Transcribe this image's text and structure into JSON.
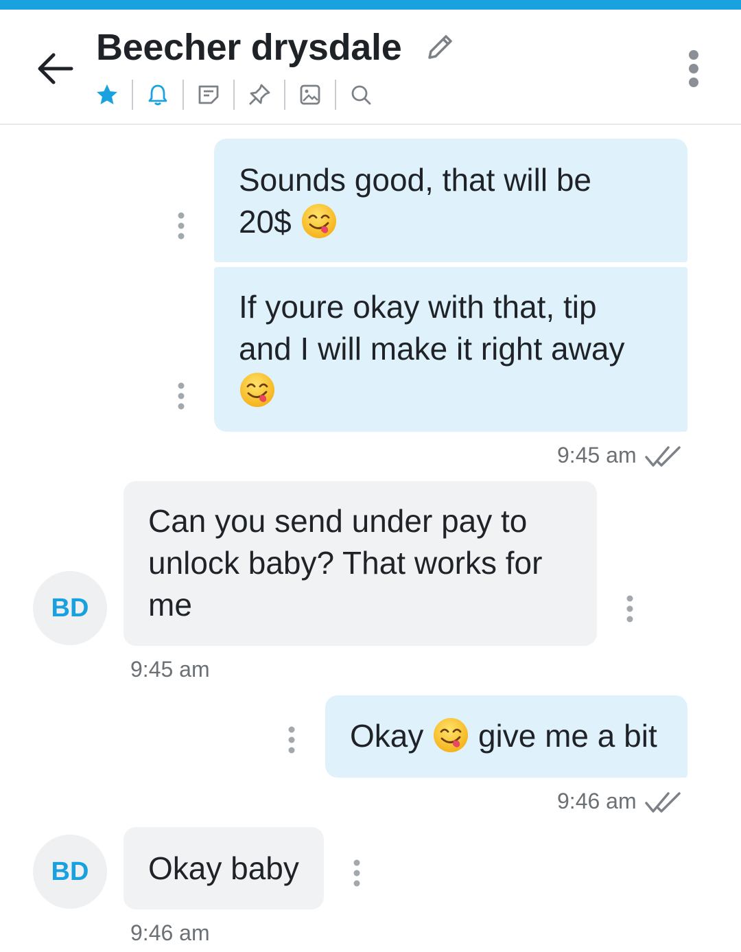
{
  "header": {
    "contact_name": "Beecher drysdale",
    "accent_color": "#1aa2e0",
    "icons": [
      "back-arrow-icon",
      "edit-pencil-icon",
      "more-vert-icon",
      "star-icon",
      "bell-icon",
      "note-icon",
      "pin-icon",
      "image-icon",
      "search-icon"
    ]
  },
  "messages": [
    {
      "sender": "me",
      "text": "Sounds good, that will be",
      "text_line2": "20$",
      "emoji": "face-savoring-food"
    },
    {
      "sender": "me",
      "text_line1": "If youre okay with that, tip",
      "text_line2": "and I will make it right away",
      "emoji": "face-savoring-food",
      "time": "9:45 am",
      "status": "read"
    },
    {
      "sender": "them",
      "initials": "BD",
      "text_line1": "Can you send under pay to",
      "text_line2": "unlock baby? That works for",
      "text_line3": "me",
      "time": "9:45 am"
    },
    {
      "sender": "me",
      "text_before": "Okay",
      "emoji": "face-savoring-food",
      "text_after": "give me a bit",
      "time": "9:46 am",
      "status": "read"
    },
    {
      "sender": "them",
      "initials": "BD",
      "text": "Okay baby",
      "time": "9:46 am"
    }
  ]
}
